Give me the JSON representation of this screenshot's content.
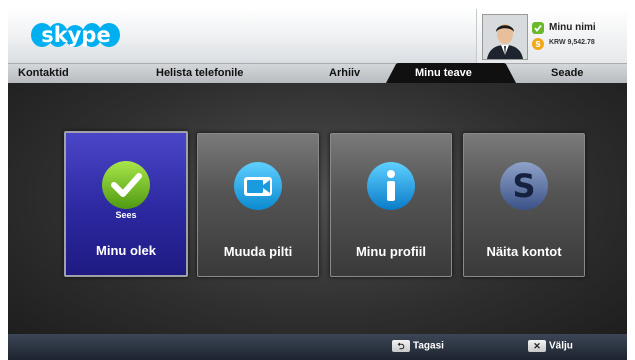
{
  "app": {
    "logo_text": "skype"
  },
  "profile": {
    "name": "Minu nimi",
    "credit": "KRW 9,542.78"
  },
  "tabs": [
    {
      "label": "Kontaktid"
    },
    {
      "label": "Helista telefonile"
    },
    {
      "label": "Arhiiv"
    },
    {
      "label": "Minu teave",
      "active": true
    },
    {
      "label": "Seade"
    }
  ],
  "tiles": [
    {
      "label": "Minu olek",
      "badge": "Sees",
      "icon": "check-status-icon",
      "selected": true
    },
    {
      "label": "Muuda pilti",
      "icon": "camera-icon"
    },
    {
      "label": "Minu profiil",
      "icon": "info-icon"
    },
    {
      "label": "Näita kontot",
      "icon": "skype-s-icon"
    }
  ],
  "bottom": {
    "back_label": "Tagasi",
    "exit_label": "Välju"
  },
  "colors": {
    "selected_tile": "#2c28a0",
    "status_online": "#6ab82c",
    "skype_blue": "#00aff0"
  }
}
